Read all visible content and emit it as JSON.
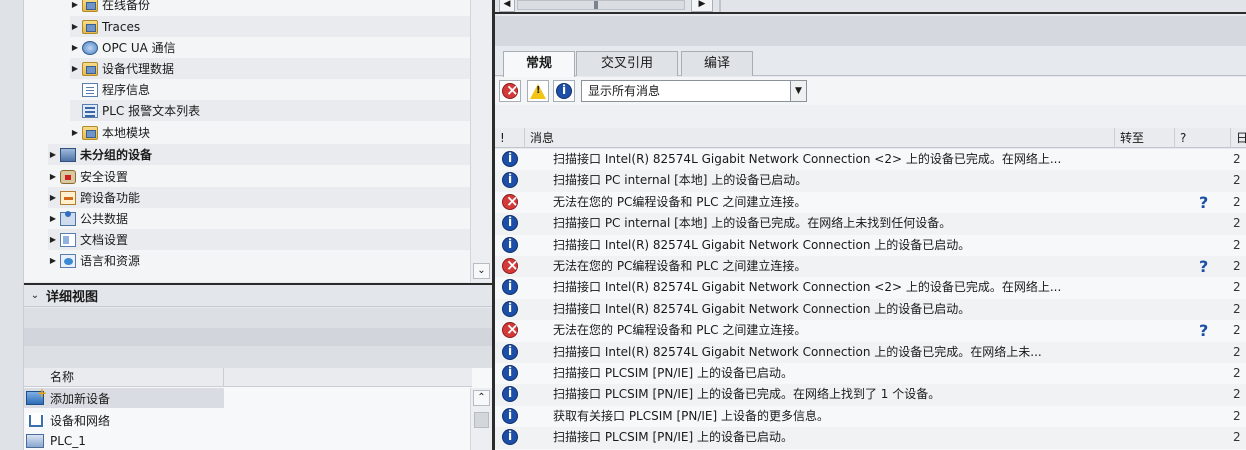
{
  "project_tree": {
    "items": [
      {
        "label": "在线备份",
        "arrow": "▶",
        "icon": "folder-icon",
        "bold": false
      },
      {
        "label": "Traces",
        "arrow": "▶",
        "icon": "folder-icon",
        "bold": false
      },
      {
        "label": "OPC UA 通信",
        "arrow": "▶",
        "icon": "opc-ua-icon",
        "bold": false
      },
      {
        "label": "设备代理数据",
        "arrow": "▶",
        "icon": "folder-icon",
        "bold": false
      },
      {
        "label": "程序信息",
        "arrow": "",
        "icon": "program-info-icon",
        "bold": false
      },
      {
        "label": "PLC 报警文本列表",
        "arrow": "",
        "icon": "alarm-text-list-icon",
        "bold": false
      },
      {
        "label": "本地模块",
        "arrow": "▶",
        "icon": "folder-icon",
        "bold": false
      },
      {
        "label": "未分组的设备",
        "arrow": "▶",
        "icon": "ungrouped-devices-icon",
        "bold": true
      },
      {
        "label": "安全设置",
        "arrow": "▶",
        "icon": "security-icon",
        "bold": false
      },
      {
        "label": "跨设备功能",
        "arrow": "▶",
        "icon": "cross-device-icon",
        "bold": false
      },
      {
        "label": "公共数据",
        "arrow": "▶",
        "icon": "common-data-icon",
        "bold": false
      },
      {
        "label": "文档设置",
        "arrow": "▶",
        "icon": "document-settings-icon",
        "bold": false
      },
      {
        "label": "语言和资源",
        "arrow": "▶",
        "icon": "language-icon",
        "bold": false
      }
    ],
    "scroll_down": "⌄"
  },
  "detail_view": {
    "collapse": "⌄",
    "title": "详细视图",
    "column_name": "名称",
    "items": [
      {
        "label": "添加新设备",
        "icon": "add-device-icon",
        "selected": true
      },
      {
        "label": "设备和网络",
        "icon": "devices-networks-icon",
        "selected": false
      },
      {
        "label": "PLC_1",
        "icon": "plc-icon",
        "selected": false
      }
    ],
    "scroll_up": "⌃"
  },
  "right_top": {
    "left_btn": "◀",
    "right_btn": "▶"
  },
  "tabs": [
    {
      "label": "常规",
      "active": true
    },
    {
      "label": "交叉引用",
      "active": false
    },
    {
      "label": "编译",
      "active": false
    }
  ],
  "toolbar": {
    "filter_value": "显示所有消息",
    "warn_mark": "!",
    "dropdown_arrow": "▼"
  },
  "messages": {
    "columns": {
      "index": "!",
      "message": "消息",
      "goto": "转至",
      "help": "?",
      "date": "日"
    },
    "rows": [
      {
        "type": "info",
        "text": "扫描接口 Intel(R) 82574L Gigabit Network Connection <2> 上的设备已完成。在网络上...",
        "help": "",
        "date": "2"
      },
      {
        "type": "info",
        "text": "扫描接口 PC internal [本地] 上的设备已启动。",
        "help": "",
        "date": "2"
      },
      {
        "type": "error",
        "text": "无法在您的 PC编程设备和 PLC 之间建立连接。",
        "help": "?",
        "date": "2"
      },
      {
        "type": "info",
        "text": "扫描接口 PC internal [本地] 上的设备已完成。在网络上未找到任何设备。",
        "help": "",
        "date": "2"
      },
      {
        "type": "info",
        "text": "扫描接口 Intel(R) 82574L Gigabit Network Connection 上的设备已启动。",
        "help": "",
        "date": "2"
      },
      {
        "type": "error",
        "text": "无法在您的 PC编程设备和 PLC 之间建立连接。",
        "help": "?",
        "date": "2"
      },
      {
        "type": "info",
        "text": "扫描接口 Intel(R) 82574L Gigabit Network Connection <2> 上的设备已完成。在网络上...",
        "help": "",
        "date": "2"
      },
      {
        "type": "info",
        "text": "扫描接口 Intel(R) 82574L Gigabit Network Connection 上的设备已启动。",
        "help": "",
        "date": "2"
      },
      {
        "type": "error",
        "text": "无法在您的 PC编程设备和 PLC 之间建立连接。",
        "help": "?",
        "date": "2"
      },
      {
        "type": "info",
        "text": "扫描接口 Intel(R) 82574L Gigabit Network Connection 上的设备已完成。在网络上未...",
        "help": "",
        "date": "2"
      },
      {
        "type": "info",
        "text": "扫描接口 PLCSIM [PN/IE] 上的设备已启动。",
        "help": "",
        "date": "2"
      },
      {
        "type": "info",
        "text": "扫描接口 PLCSIM [PN/IE] 上的设备已完成。在网络上找到了 1 个设备。",
        "help": "",
        "date": "2"
      },
      {
        "type": "info",
        "text": "获取有关接口 PLCSIM [PN/IE] 上设备的更多信息。",
        "help": "",
        "date": "2"
      },
      {
        "type": "info",
        "text": "扫描接口 PLCSIM [PN/IE] 上的设备已启动。",
        "help": "",
        "date": "2"
      }
    ]
  }
}
